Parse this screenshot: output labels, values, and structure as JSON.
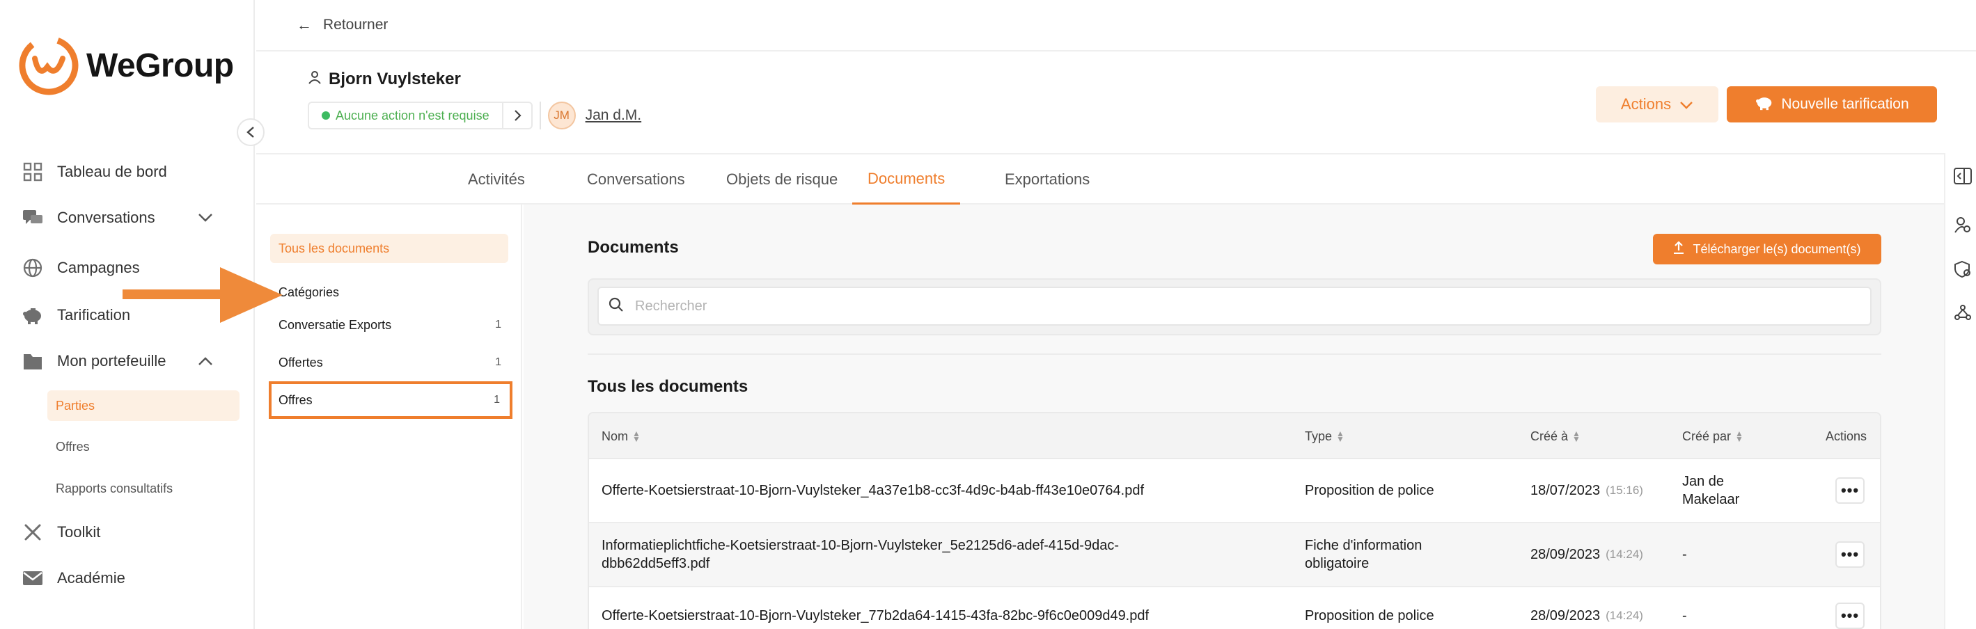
{
  "brand": {
    "name": "WeGroup",
    "accent": "#EF7E2D"
  },
  "sidebar": {
    "items": [
      {
        "label": "Tableau de bord",
        "icon": "dashboard-icon"
      },
      {
        "label": "Conversations",
        "icon": "chat-icon"
      },
      {
        "label": "Campagnes",
        "icon": "globe-icon"
      },
      {
        "label": "Tarification",
        "icon": "piggy-bank-icon"
      },
      {
        "label": "Mon portefeuille",
        "icon": "folder-icon"
      },
      {
        "label": "Toolkit",
        "icon": "tools-icon"
      },
      {
        "label": "Académie",
        "icon": "mail-icon"
      }
    ],
    "portfolio_sub": [
      "Parties",
      "Offres",
      "Rapports consultatifs"
    ]
  },
  "header": {
    "back_label": "Retourner",
    "client_name": "Bjorn Vuylsteker",
    "status": "Aucune action n'est requise",
    "agent_initials": "JM",
    "agent_name": "Jan d.M.",
    "actions_label": "Actions",
    "new_label": "Nouvelle tarification"
  },
  "tabs": [
    "Activités",
    "Conversations",
    "Objets de risque",
    "Documents",
    "Exportations"
  ],
  "active_tab": "Documents",
  "categories": {
    "all_label": "Tous les documents",
    "heading": "Catégories",
    "items": [
      {
        "label": "Conversatie Exports",
        "count": "1"
      },
      {
        "label": "Offertes",
        "count": "1"
      },
      {
        "label": "Offres",
        "count": "1"
      }
    ]
  },
  "documents": {
    "title": "Documents",
    "upload_label": "Télécharger le(s) document(s)",
    "search_placeholder": "Rechercher",
    "section_title": "Tous les documents",
    "columns": [
      "Nom",
      "Type",
      "Créé à",
      "Créé par",
      "Actions"
    ],
    "rows": [
      {
        "name": "Offerte-Koetsierstraat-10-Bjorn-Vuylsteker_4a37e1b8-cc3f-4d9c-b4ab-ff43e10e0764.pdf",
        "type": "Proposition de police",
        "date": "18/07/2023",
        "time": "(15:16)",
        "by": "Jan de Makelaar"
      },
      {
        "name": "Informatieplichtfiche-Koetsierstraat-10-Bjorn-Vuylsteker_5e2125d6-adef-415d-9dac-dbb62dd5eff3.pdf",
        "type": "Fiche d'information obligatoire",
        "date": "28/09/2023",
        "time": "(14:24)",
        "by": "-"
      },
      {
        "name": "Offerte-Koetsierstraat-10-Bjorn-Vuylsteker_77b2da64-1415-43fa-82bc-9f6c0e009d49.pdf",
        "type": "Proposition de police",
        "date": "28/09/2023",
        "time": "(14:24)",
        "by": "-"
      }
    ]
  }
}
